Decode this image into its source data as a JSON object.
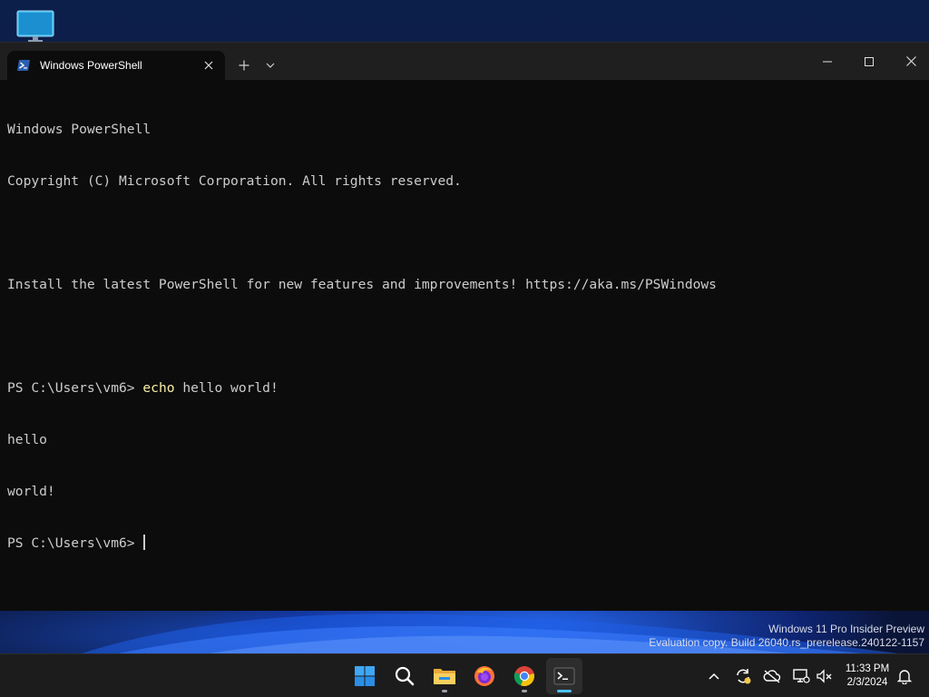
{
  "window": {
    "tab_title": "Windows PowerShell"
  },
  "terminal": {
    "lines": [
      {
        "prompt": "",
        "cmd": "",
        "rest": "Windows PowerShell"
      },
      {
        "prompt": "",
        "cmd": "",
        "rest": "Copyright (C) Microsoft Corporation. All rights reserved."
      },
      {
        "prompt": "",
        "cmd": "",
        "rest": ""
      },
      {
        "prompt": "",
        "cmd": "",
        "rest": "Install the latest PowerShell for new features and improvements! https://aka.ms/PSWindows"
      },
      {
        "prompt": "",
        "cmd": "",
        "rest": ""
      },
      {
        "prompt": "PS C:\\Users\\vm6> ",
        "cmd": "echo",
        "rest": " hello world!"
      },
      {
        "prompt": "",
        "cmd": "",
        "rest": "hello"
      },
      {
        "prompt": "",
        "cmd": "",
        "rest": "world!"
      }
    ],
    "current_prompt": "PS C:\\Users\\vm6> "
  },
  "watermark": {
    "line1": "Windows 11 Pro Insider Preview",
    "line2": "Evaluation copy. Build 26040.rs_prerelease.240122-1157"
  },
  "taskbar": {
    "apps": [
      {
        "name": "start-button",
        "icon": "windows-logo-icon"
      },
      {
        "name": "search-button",
        "icon": "search-icon"
      },
      {
        "name": "file-explorer-button",
        "icon": "folder-icon"
      },
      {
        "name": "firefox-button",
        "icon": "firefox-icon"
      },
      {
        "name": "chrome-button",
        "icon": "chrome-icon"
      },
      {
        "name": "terminal-button",
        "icon": "terminal-icon"
      }
    ],
    "clock_time": "11:33 PM",
    "clock_date": "2/3/2024"
  },
  "colors": {
    "terminal_bg": "#0c0c0c",
    "titlebar_bg": "#1f1f1f",
    "command_yellow": "#f9f1a5",
    "accent_blue": "#4cc2ff"
  }
}
